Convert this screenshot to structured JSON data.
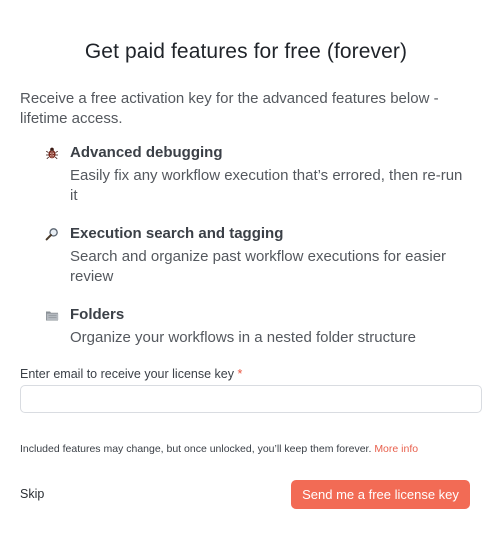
{
  "modal": {
    "title": "Get paid features for free (forever)",
    "intro": "Receive a free activation key for the advanced features below - lifetime access."
  },
  "features": [
    {
      "icon": "bug-icon",
      "title": "Advanced debugging",
      "description": "Easily fix any workflow execution that’s errored, then re-run it"
    },
    {
      "icon": "magnifier-icon",
      "title": "Execution search and tagging",
      "description": "Search and organize past workflow executions for easier review"
    },
    {
      "icon": "folder-icon",
      "title": "Folders",
      "description": "Organize your workflows in a nested folder structure"
    }
  ],
  "form": {
    "email_label": "Enter email to receive your license key",
    "required_marker": "*",
    "email_value": "",
    "email_placeholder": ""
  },
  "note": {
    "text": "Included features may change, but once unlocked, you’ll keep them forever.",
    "link": "More info"
  },
  "actions": {
    "skip": "Skip",
    "send": "Send me a free license key"
  },
  "colors": {
    "accent": "#f26b55",
    "link": "#e8604d",
    "required": "#e8553f"
  }
}
